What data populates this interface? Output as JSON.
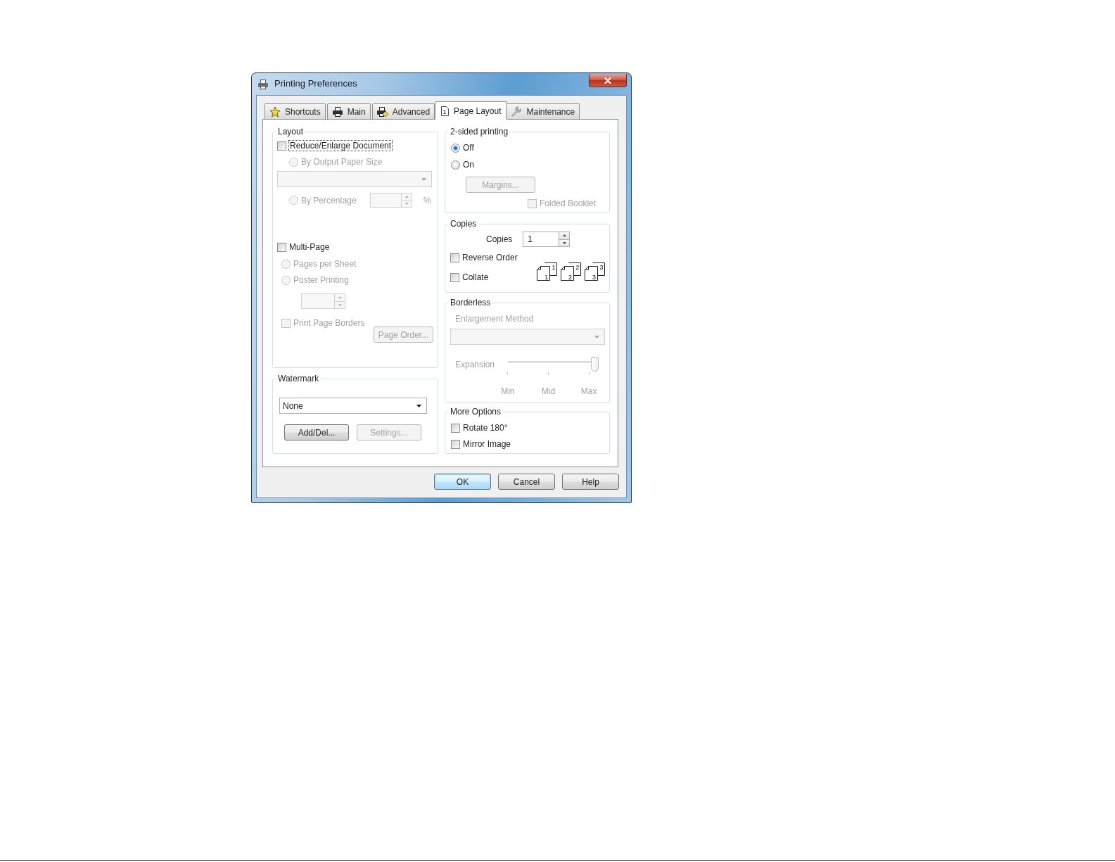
{
  "window": {
    "title": "Printing Preferences"
  },
  "tabs": [
    {
      "label": "Shortcuts",
      "selected": false
    },
    {
      "label": "Main",
      "selected": false
    },
    {
      "label": "Advanced",
      "selected": false
    },
    {
      "label": "Page Layout",
      "selected": true,
      "icon_text": "1"
    },
    {
      "label": "Maintenance",
      "selected": false
    }
  ],
  "layout": {
    "title": "Layout",
    "reduce_enlarge": {
      "label": "Reduce/Enlarge Document",
      "checked": false,
      "focused": true
    },
    "by_output_paper_size": {
      "label": "By Output Paper Size",
      "selected": false,
      "disabled": true
    },
    "paper_size": {
      "disabled": true
    },
    "by_percentage": {
      "label": "By Percentage",
      "selected": false,
      "disabled": true
    },
    "percentage": {
      "disabled": true,
      "unit": "%"
    },
    "multi_page": {
      "label": "Multi-Page",
      "checked": false
    },
    "pages_per_sheet": {
      "label": "Pages per Sheet",
      "selected": false,
      "disabled": true
    },
    "poster_printing": {
      "label": "Poster Printing",
      "selected": false,
      "disabled": true
    },
    "page_count": {
      "disabled": true
    },
    "print_page_borders": {
      "label": "Print Page Borders",
      "checked": false,
      "disabled": true
    },
    "page_order_button": {
      "label": "Page Order...",
      "disabled": true
    }
  },
  "watermark": {
    "title": "Watermark",
    "value": "None",
    "add_del_button": {
      "label": "Add/Del...",
      "disabled": false
    },
    "settings_button": {
      "label": "Settings...",
      "disabled": true
    }
  },
  "two_sided": {
    "title": "2-sided printing",
    "options": [
      {
        "label": "Off",
        "selected": true
      },
      {
        "label": "On",
        "selected": false
      }
    ],
    "margins_button": {
      "label": "Margins...",
      "disabled": true
    },
    "folded_booklet": {
      "label": "Folded Booklet",
      "checked": false,
      "disabled": true
    }
  },
  "copies": {
    "title": "Copies",
    "label": "Copies",
    "value": "1",
    "reverse_order": {
      "label": "Reverse Order",
      "checked": false
    },
    "collate": {
      "label": "Collate",
      "checked": false
    },
    "collate_preview": [
      {
        "front": "1",
        "back": "1"
      },
      {
        "front": "2",
        "back": "2"
      },
      {
        "front": "3",
        "back": "3"
      }
    ]
  },
  "borderless": {
    "title": "Borderless",
    "disabled": true,
    "method_label": "Enlargement Method",
    "expansion_label": "Expansion",
    "level": 1,
    "scale": [
      "Min",
      "Mid",
      "Max"
    ]
  },
  "more_options": {
    "title": "More Options",
    "items": [
      {
        "label": "Rotate 180°",
        "checked": false
      },
      {
        "label": "Mirror Image",
        "checked": false
      }
    ]
  },
  "buttons": [
    {
      "label": "OK",
      "default": true
    },
    {
      "label": "Cancel",
      "default": false
    },
    {
      "label": "Help",
      "default": false
    }
  ]
}
